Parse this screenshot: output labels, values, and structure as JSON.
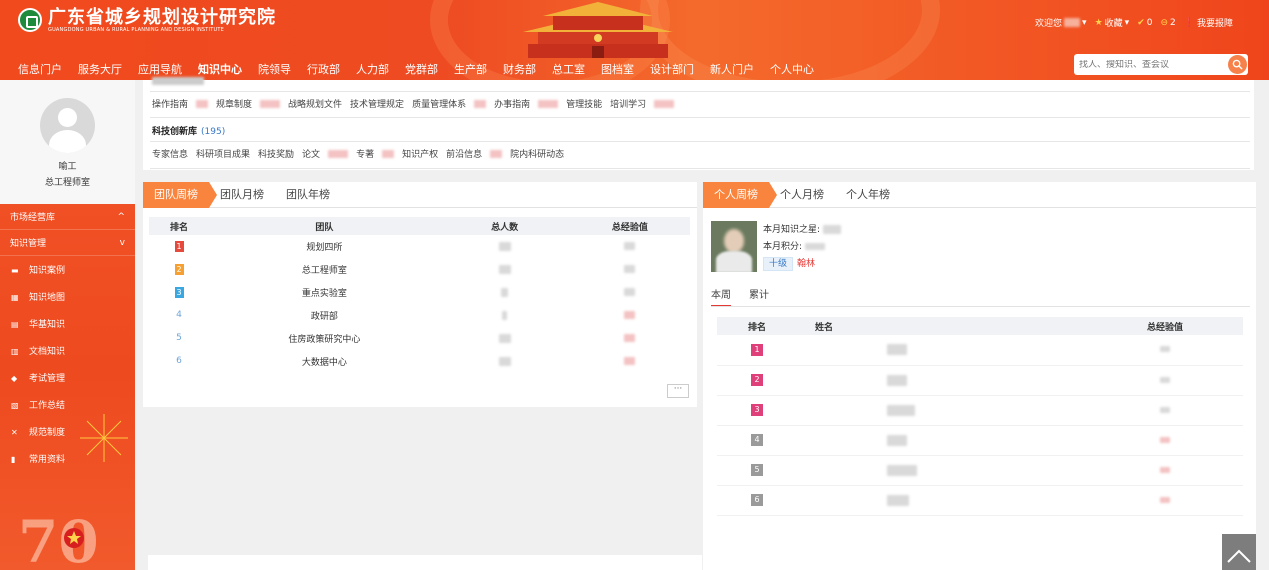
{
  "header": {
    "title": "广东省城乡规划设计研究院",
    "subtitle": "GUANGDONG URBAN & RURAL PLANNING AND DESIGN INSTITUTE",
    "welcome": "欢迎您",
    "favorites": "收藏",
    "count_a": "0",
    "count_b": "2",
    "report": "我要报障",
    "search_placeholder": "找人、搜知识、查会议"
  },
  "nav": [
    "信息门户",
    "服务大厅",
    "应用导航",
    "知识中心",
    "院领导",
    "行政部",
    "人力部",
    "党群部",
    "生产部",
    "财务部",
    "总工室",
    "图档室",
    "设计部门",
    "新人门户",
    "个人中心"
  ],
  "nav_active": "知识中心",
  "profile": {
    "name": "喻工",
    "role": "总工程师室"
  },
  "sidebar": {
    "sections": [
      {
        "label": "市场经营库",
        "arrow": "^"
      },
      {
        "label": "知识管理",
        "arrow": "v"
      }
    ],
    "items": [
      {
        "label": "知识案例",
        "icon": "book-icon"
      },
      {
        "label": "知识地图",
        "icon": "map-icon"
      },
      {
        "label": "华基知识",
        "icon": "grid-icon"
      },
      {
        "label": "文档知识",
        "icon": "document-icon"
      },
      {
        "label": "考试管理",
        "icon": "exam-icon"
      },
      {
        "label": "工作总结",
        "icon": "edit-icon"
      },
      {
        "label": "规范制度",
        "icon": "tools-icon"
      },
      {
        "label": "常用资料",
        "icon": "library-icon"
      }
    ]
  },
  "library": {
    "row1": [
      "操作指南",
      "规章制度",
      "战略规划文件",
      "技术管理规定",
      "质量管理体系",
      "办事指南",
      "管理技能",
      "培训学习"
    ],
    "innovation_title": "科技创新库",
    "innovation_count": "(195)",
    "row2": [
      "专家信息",
      "科研项目成果",
      "科技奖励",
      "论文",
      "专著",
      "知识产权",
      "前沿信息",
      "院内科研动态"
    ]
  },
  "team_board": {
    "tabs": [
      "团队周榜",
      "团队月榜",
      "团队年榜"
    ],
    "active_tab": "团队周榜",
    "headers": [
      "排名",
      "团队",
      "总人数",
      "总经验值"
    ],
    "rows": [
      {
        "rank": "1",
        "team": "规划四所"
      },
      {
        "rank": "2",
        "team": "总工程师室"
      },
      {
        "rank": "3",
        "team": "重点实验室"
      },
      {
        "rank": "4",
        "team": "政研部"
      },
      {
        "rank": "5",
        "team": "住房政策研究中心"
      },
      {
        "rank": "6",
        "team": "大数据中心"
      }
    ],
    "more": "···"
  },
  "personal_board": {
    "tabs": [
      "个人周榜",
      "个人月榜",
      "个人年榜"
    ],
    "active_tab": "个人周榜",
    "month_knowledge_label": "本月知识之星:",
    "month_points_label": "本月积分:",
    "level": "十级",
    "title": "翰林",
    "subtabs": [
      "本周",
      "累计"
    ],
    "active_subtab": "本周",
    "headers": [
      "排名",
      "姓名",
      "总经验值"
    ],
    "ranks": [
      "1",
      "2",
      "3",
      "4",
      "5",
      "6"
    ],
    "more": "···"
  },
  "colors": {
    "brand": "#ee4b22",
    "tab_active": "#f8843e",
    "link": "#3778c7"
  }
}
